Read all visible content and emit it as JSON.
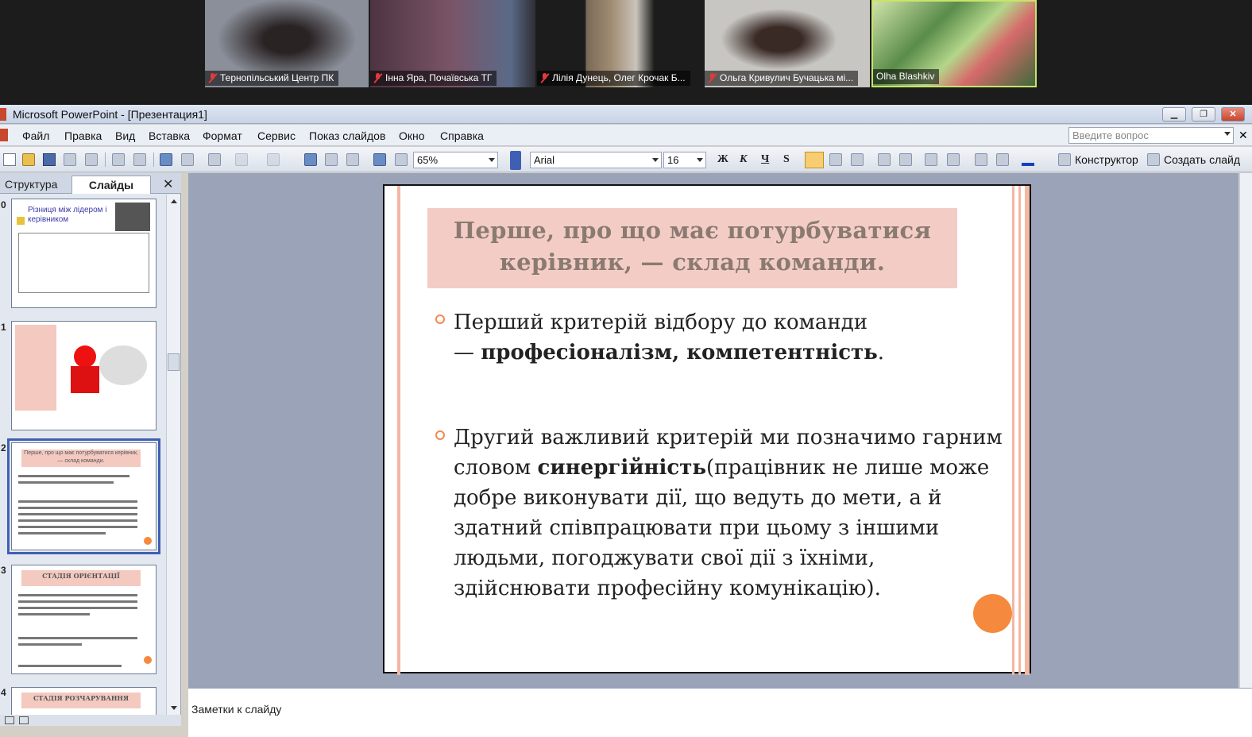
{
  "video_tiles": [
    {
      "name": "Тернопільський Центр ПК",
      "muted": true,
      "bg": "#8a8f99"
    },
    {
      "name": "Інна Яра, Почаївська ТГ",
      "muted": true,
      "bg": "#6d4a5c"
    },
    {
      "name": "Лілія Дунець, Олег Крочак Б...",
      "muted": true,
      "bg": "#b8b4ac"
    },
    {
      "name": "Ольга Кривулич Бучацька мі...",
      "muted": true,
      "bg": "#c7c6c2"
    },
    {
      "name": "Olha Blashkiv",
      "muted": false,
      "bg": "#5a8c4a"
    }
  ],
  "window": {
    "title": "Microsoft PowerPoint - [Презентация1]",
    "controls": [
      "minimize-icon",
      "restore-icon",
      "close-icon"
    ]
  },
  "menu": [
    "Файл",
    "Правка",
    "Вид",
    "Вставка",
    "Формат",
    "Сервис",
    "Показ слайдов",
    "Окно",
    "Справка"
  ],
  "help_box": {
    "placeholder": "Введите вопрос"
  },
  "toolbar": {
    "zoom": "65%",
    "font": "Arial",
    "size": "16",
    "bold": "Ж",
    "italic": "К",
    "underline": "Ч",
    "shadow": "S",
    "designer": "Конструктор",
    "new_slide": "Создать слайд"
  },
  "pane": {
    "tabs": [
      "Структура",
      "Слайды"
    ],
    "active_tab": "Слайды",
    "thumbnails": [
      {
        "num": "0",
        "title": "Різниця між лідером і керівником"
      },
      {
        "num": "1",
        "title": ""
      },
      {
        "num": "2",
        "title": "Перше, про що має потурбуватися керівник, — склад команди."
      },
      {
        "num": "3",
        "title": "СТАДІЯ ОРІЄНТАЦІЇ"
      },
      {
        "num": "4",
        "title": "СТАДІЯ РОЗЧАРУВАННЯ"
      }
    ]
  },
  "slide": {
    "title_line1": "Перше, про що має потурбуватися",
    "title_line2": "керівник, — склад команди.",
    "b1_line1": "Перший критерій відбору до команди",
    "b1_dash": "— ",
    "b1_bold": "професіоналізм, компетентність",
    "b1_end": ".",
    "b2_pre": "Другий важливий критерій ми позначимо гарним словом ",
    "b2_bold": "синергійність",
    "b2_post": "(працівник не лише може добре виконувати дії, що ведуть до мети, а й здатний співпрацювати при цьому з іншими людьми, погоджувати свої дії з їхніми, здійснювати професійну комунікацію)."
  },
  "notes": {
    "placeholder": "Заметки к слайду"
  }
}
